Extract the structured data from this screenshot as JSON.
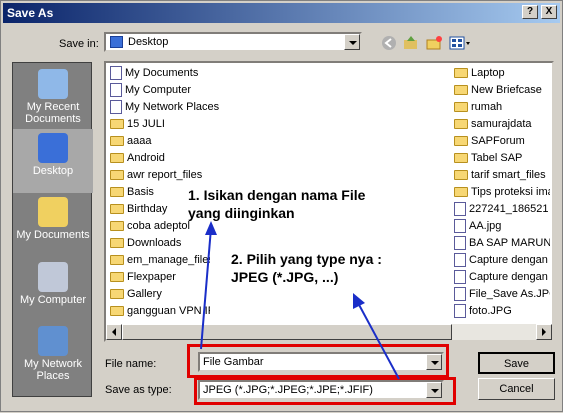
{
  "window": {
    "title": "Save As",
    "help_btn": "?",
    "close_btn": "X"
  },
  "save_in": {
    "label": "Save in:",
    "value": "Desktop"
  },
  "places": [
    {
      "label": "My Recent Documents"
    },
    {
      "label": "Desktop"
    },
    {
      "label": "My Documents"
    },
    {
      "label": "My Computer"
    },
    {
      "label": "My Network Places"
    }
  ],
  "files_col1": [
    "My Documents",
    "My Computer",
    "My Network Places",
    "15 JULI",
    "aaaa",
    "Android",
    "awr report_files",
    "Basis",
    "Birthday",
    "coba adeptol",
    "Downloads",
    "em_manage_files",
    "Flexpaper",
    "Gallery",
    "gangguan VPN IP"
  ],
  "files_col2": [
    "Laptop",
    "New Briefcase",
    "rumah",
    "samurajdata",
    "SAPForum",
    "Tabel SAP",
    "tarif smart_files",
    "Tips proteksi image",
    "227241_186521",
    "AA.jpg",
    "BA SAP MARUND",
    "Capture dengan",
    "Capture dengan",
    "File_Save As.JPG",
    "foto.JPG"
  ],
  "file_name": {
    "label": "File name:",
    "value": "File Gambar"
  },
  "save_type": {
    "label": "Save as type:",
    "value": "JPEG (*.JPG;*.JPEG;*.JPE;*.JFIF)"
  },
  "buttons": {
    "save": "Save",
    "cancel": "Cancel"
  },
  "annotations": {
    "step1_line1": "1. Isikan dengan nama File",
    "step1_line2": "yang diinginkan",
    "step2_line1": "2. Pilih yang type nya :",
    "step2_line2": "JPEG (*.JPG, ...)"
  }
}
